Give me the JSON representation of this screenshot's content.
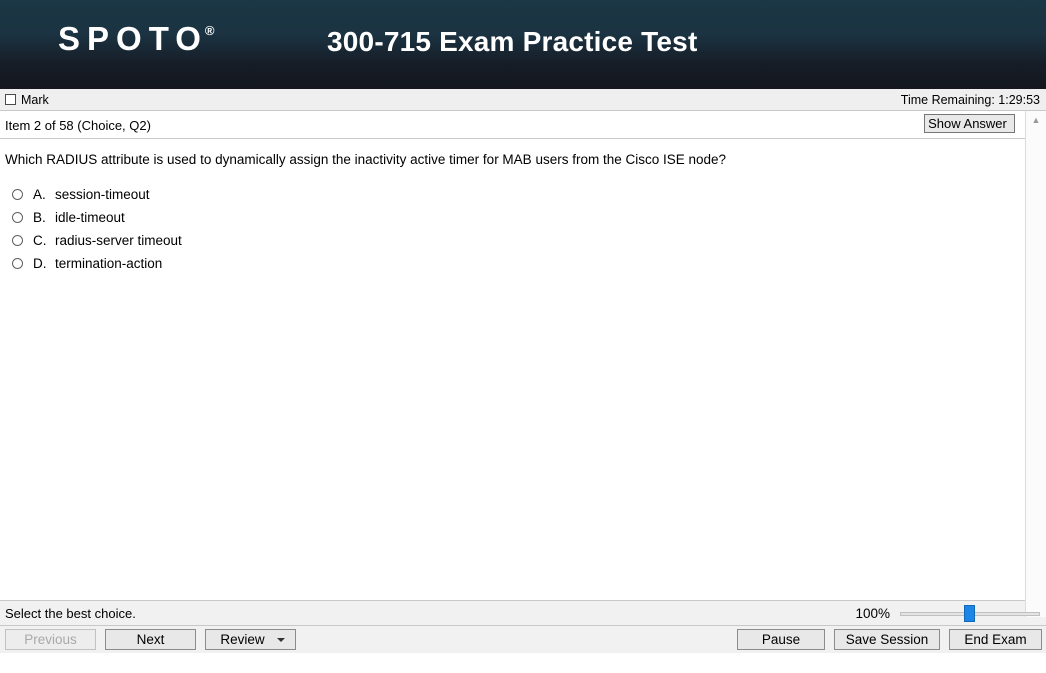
{
  "header": {
    "logo_text": "SPOTO",
    "logo_trademark": "®",
    "title": "300-715 Exam Practice Test"
  },
  "toolbar": {
    "mark_label": "Mark",
    "time_remaining": "Time Remaining: 1:29:53"
  },
  "itembar": {
    "item_label": "Item 2 of 58  (Choice, Q2)",
    "show_answer_label": "Show Answer"
  },
  "question": {
    "text": "Which RADIUS attribute is used to dynamically assign the inactivity active timer for MAB users from the Cisco ISE node?",
    "options": [
      {
        "letter": "A.",
        "text": "session-timeout",
        "selected": false
      },
      {
        "letter": "B.",
        "text": "idle-timeout",
        "selected": false
      },
      {
        "letter": "C.",
        "text": "radius-server timeout",
        "selected": false
      },
      {
        "letter": "D.",
        "text": "termination-action",
        "selected": false
      }
    ]
  },
  "statusbar": {
    "hint": "Select the best choice.",
    "zoom_level": "100%"
  },
  "buttons": {
    "previous": "Previous",
    "next": "Next",
    "review": "Review",
    "pause": "Pause",
    "save_session": "Save Session",
    "end_exam": "End Exam"
  },
  "colors": {
    "header_top": "#1b3644",
    "header_bottom": "#14171d",
    "slider_thumb": "#1b85e8",
    "toolbar_bg": "#efefef"
  }
}
